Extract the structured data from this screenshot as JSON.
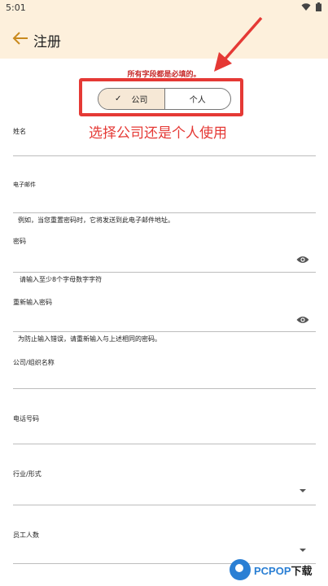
{
  "status_bar": {
    "time": "5:01"
  },
  "app_bar": {
    "title": "注册"
  },
  "form": {
    "required_note": "所有字段都是必填的。",
    "toggle": {
      "company_label": "公司",
      "personal_label": "个人",
      "selected": "company"
    },
    "annotation": "选择公司还是个人使用",
    "fields": {
      "name": {
        "label": "姓名"
      },
      "email": {
        "label": "电子邮件",
        "help": "例如，当您重置密码时，它将发送到此电子邮件地址。"
      },
      "password": {
        "label": "密码",
        "help": "请输入至少8个字母数字字符"
      },
      "confirm_password": {
        "label": "重新输入密码",
        "help": "为防止输入错误，请重新输入与上述相同的密码。"
      },
      "organization": {
        "label": "公司/组织名称"
      },
      "phone": {
        "label": "电话号码"
      },
      "industry": {
        "label": "行业/形式"
      },
      "employees": {
        "label": "员工人数"
      }
    }
  },
  "watermark": {
    "brand": "PCPOP",
    "brand_suffix": "下载"
  },
  "colors": {
    "header_bg": "#fdf0dc",
    "accent": "#e53935",
    "selected_segment": "#f6e8d6"
  }
}
